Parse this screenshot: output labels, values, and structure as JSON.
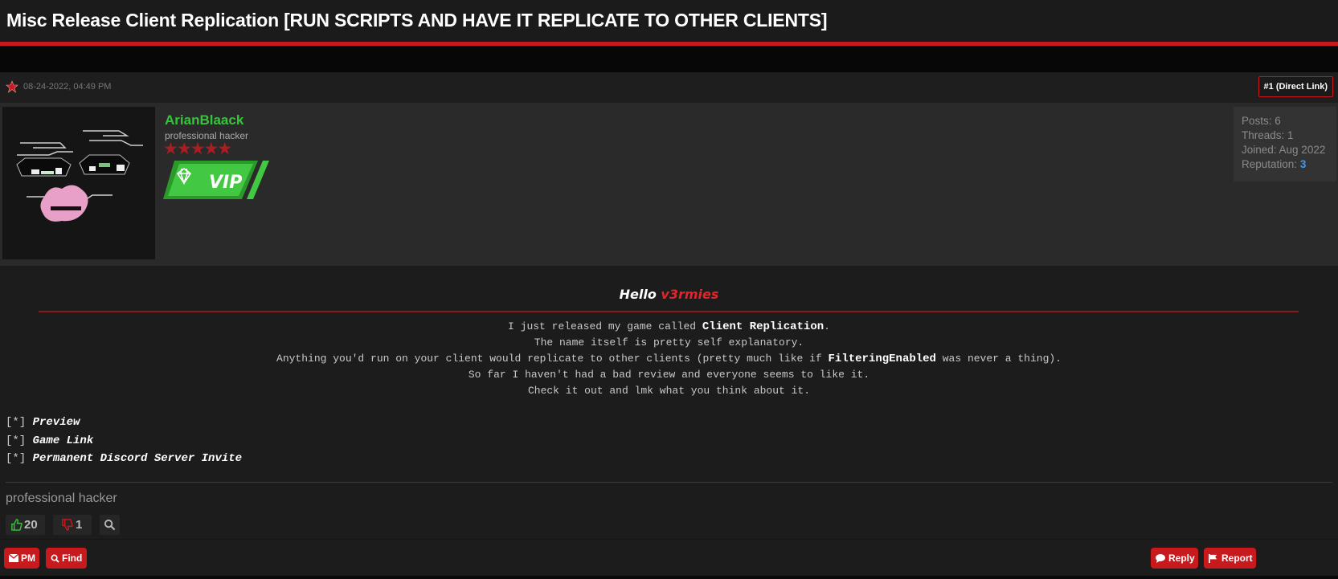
{
  "thread": {
    "title": "Misc Release Client Replication [RUN SCRIPTS AND HAVE IT REPLICATE TO OTHER CLIENTS]"
  },
  "post": {
    "date": "08-24-2022, 04:49 PM",
    "link_label": "#1 (Direct Link)",
    "author": {
      "name": "ArianBlaack",
      "usertitle": "professional hacker",
      "stars": "★★★★★",
      "badge": "VIP",
      "posts": "Posts: 6",
      "threads": "Threads: 1",
      "joined": "Joined: Aug 2022",
      "reputation_label": "Reputation: ",
      "reputation_value": "3"
    },
    "hello_prefix": "Hello ",
    "hello_highlight": "v3rmies",
    "body": {
      "line1_a": "I just released my game called ",
      "line1_b": "Client Replication",
      "line1_c": ".",
      "line2": "The name itself is pretty self explanatory.",
      "line3_a": "Anything you'd run on your client would replicate to other clients (pretty much like if ",
      "line3_b": "FilteringEnabled",
      "line3_c": " was never a thing).",
      "line4": "So far I haven't had a bad review and everyone seems to like it.",
      "line5": "Check it out and lmk what you think about it."
    },
    "links": [
      {
        "bullet": "[*] ",
        "label": "Preview"
      },
      {
        "bullet": "[*] ",
        "label": "Game Link"
      },
      {
        "bullet": "[*] ",
        "label": "Permanent Discord Server Invite"
      }
    ],
    "signature": "professional hacker",
    "likes": "20",
    "dislikes": "1"
  },
  "footer": {
    "pm": "PM",
    "find": "Find",
    "reply": "Reply",
    "report": "Report"
  },
  "colors": {
    "accent": "#c8191d",
    "username": "#36c53a",
    "reputation": "#3f9bf2",
    "background": "#1a1a1a"
  }
}
